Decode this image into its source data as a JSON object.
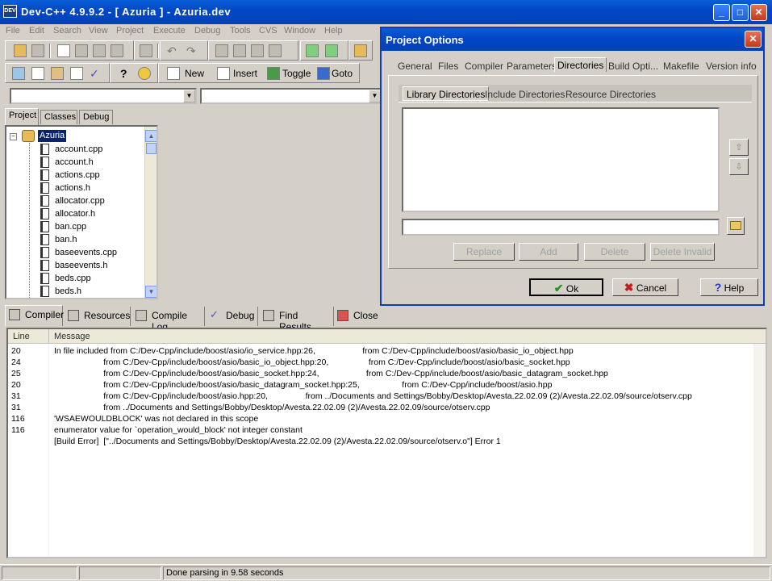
{
  "window": {
    "icon_text": "DEV",
    "title": "Dev-C++ 4.9.9.2  -  [ Azuria ] - Azuria.dev",
    "minimize": "_",
    "maximize": "□",
    "close": "✕"
  },
  "menu": [
    "File",
    "Edit",
    "Search",
    "View",
    "Project",
    "Execute",
    "Debug",
    "Tools",
    "CVS",
    "Window",
    "Help"
  ],
  "toolbar": {
    "new_label": "New",
    "insert_label": "Insert",
    "toggle_label": "Toggle",
    "goto_label": "Goto"
  },
  "left_tabs": [
    "Project",
    "Classes",
    "Debug"
  ],
  "tree": {
    "root": "Azuria",
    "files": [
      "account.cpp",
      "account.h",
      "actions.cpp",
      "actions.h",
      "allocator.cpp",
      "allocator.h",
      "ban.cpp",
      "ban.h",
      "baseevents.cpp",
      "baseevents.h",
      "beds.cpp",
      "beds.h"
    ]
  },
  "bottom_tabs": [
    "Compiler",
    "Resources",
    "Compile Log",
    "Debug",
    "Find Results",
    "Close"
  ],
  "messages": {
    "headers": {
      "line": "Line",
      "message": "Message"
    },
    "rows": [
      {
        "line": "20",
        "text": "In file included from C:/Dev-Cpp/include/boost/asio/io_service.hpp:26,                    from C:/Dev-Cpp/include/boost/asio/basic_io_object.hpp"
      },
      {
        "line": "24",
        "text": "                     from C:/Dev-Cpp/include/boost/asio/basic_io_object.hpp:20,                 from C:/Dev-Cpp/include/boost/asio/basic_socket.hpp"
      },
      {
        "line": "25",
        "text": "                     from C:/Dev-Cpp/include/boost/asio/basic_socket.hpp:24,                    from C:/Dev-Cpp/include/boost/asio/basic_datagram_socket.hpp"
      },
      {
        "line": "20",
        "text": "                     from C:/Dev-Cpp/include/boost/asio/basic_datagram_socket.hpp:25,                  from C:/Dev-Cpp/include/boost/asio.hpp"
      },
      {
        "line": "31",
        "text": "                     from C:/Dev-Cpp/include/boost/asio.hpp:20,                from ../Documents and Settings/Bobby/Desktop/Avesta.22.02.09 (2)/Avesta.22.02.09/source/otserv.cpp"
      },
      {
        "line": "31",
        "text": "                     from ../Documents and Settings/Bobby/Desktop/Avesta.22.02.09 (2)/Avesta.22.02.09/source/otserv.cpp"
      },
      {
        "line": "116",
        "text": "'WSAEWOULDBLOCK' was not declared in this scope"
      },
      {
        "line": "116",
        "text": "enumerator value for `operation_would_block' not integer constant"
      },
      {
        "line": "",
        "text": "[Build Error]  [\"../Documents and Settings/Bobby/Desktop/Avesta.22.02.09 (2)/Avesta.22.02.09/source/otserv.o\"] Error 1"
      }
    ]
  },
  "status": {
    "left": "",
    "middle": "",
    "right": "Done parsing in 9.58 seconds"
  },
  "dialog": {
    "title": "Project Options",
    "tabs": [
      "General",
      "Files",
      "Compiler",
      "Parameters",
      "Directories",
      "Build Opti...",
      "Makefile",
      "Version info"
    ],
    "active_tab": "Directories",
    "inner_tabs": [
      "Library Directories",
      "Include Directories",
      "Resource Directories"
    ],
    "path_value": "",
    "buttons": {
      "replace": "Replace",
      "add": "Add",
      "delete": "Delete",
      "delete_invalid": "Delete Invalid"
    },
    "footer": {
      "ok": "Ok",
      "cancel": "Cancel",
      "help": "Help"
    }
  }
}
